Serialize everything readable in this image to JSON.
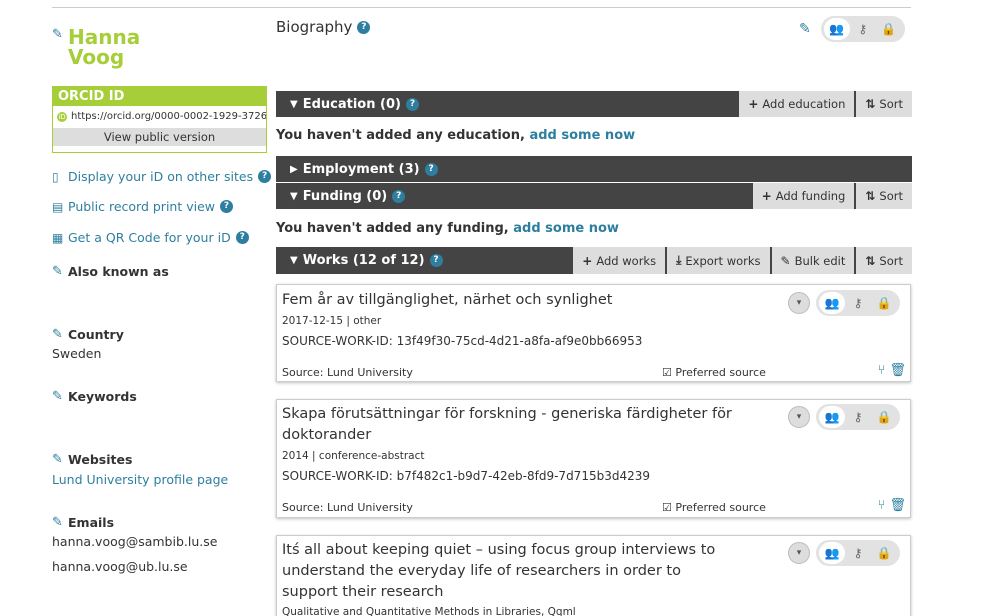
{
  "profile": {
    "name_first": "Hanna",
    "name_last": "Voog"
  },
  "orcid": {
    "title": "ORCID ID",
    "url": "https://orcid.org/0000-0002-1929-3726",
    "view_public": "View public version"
  },
  "side_links": {
    "display_id": "Display your iD on other sites",
    "print_view": "Public record print view",
    "qr_code": "Get a QR Code for your iD"
  },
  "side_sections": {
    "also_known_as": "Also known as",
    "country": "Country",
    "country_value": "Sweden",
    "keywords": "Keywords",
    "websites": "Websites",
    "website_link": "Lund University profile page",
    "emails": "Emails",
    "email_1": "hanna.voog@sambib.lu.se",
    "email_2": "hanna.voog@ub.lu.se"
  },
  "biography": {
    "title": "Biography"
  },
  "education": {
    "label": "Education (0)",
    "add": "Add education",
    "sort": "Sort",
    "empty_text": "You haven't added any education,",
    "empty_link": "add some now"
  },
  "employment": {
    "label": "Employment (3)"
  },
  "funding": {
    "label": "Funding (0)",
    "add": "Add funding",
    "sort": "Sort",
    "empty_text": "You haven't added any funding,",
    "empty_link": "add some now"
  },
  "works": {
    "label": "Works (12 of 12)",
    "add": "Add works",
    "export": "Export works",
    "bulk": "Bulk edit",
    "sort": "Sort",
    "items": [
      {
        "title": "Fem år av tillgänglighet, närhet och synlighet",
        "meta": "2017-12-15 | other",
        "source_id": "SOURCE-WORK-ID: 13f49f30-75cd-4d21-a8fa-af9e0bb66953",
        "source": "Source: Lund University",
        "preferred": "Preferred source"
      },
      {
        "title": "Skapa förutsättningar för forskning - generiska färdigheter för doktorander",
        "meta": "2014 | conference-abstract",
        "source_id": "SOURCE-WORK-ID: b7f482c1-b9d7-42eb-8fd9-7d715b3d4239",
        "source": "Source: Lund University",
        "preferred": "Preferred source"
      },
      {
        "title": "Itś all about keeping quiet – using focus group interviews to understand the everyday life of researchers in order to support their research",
        "meta": "Qualitative and Quantitative Methods in Libraries, Qqml"
      }
    ]
  },
  "colors": {
    "accent": "#a6ce39",
    "link": "#2e7f9f",
    "bar": "#444444"
  }
}
